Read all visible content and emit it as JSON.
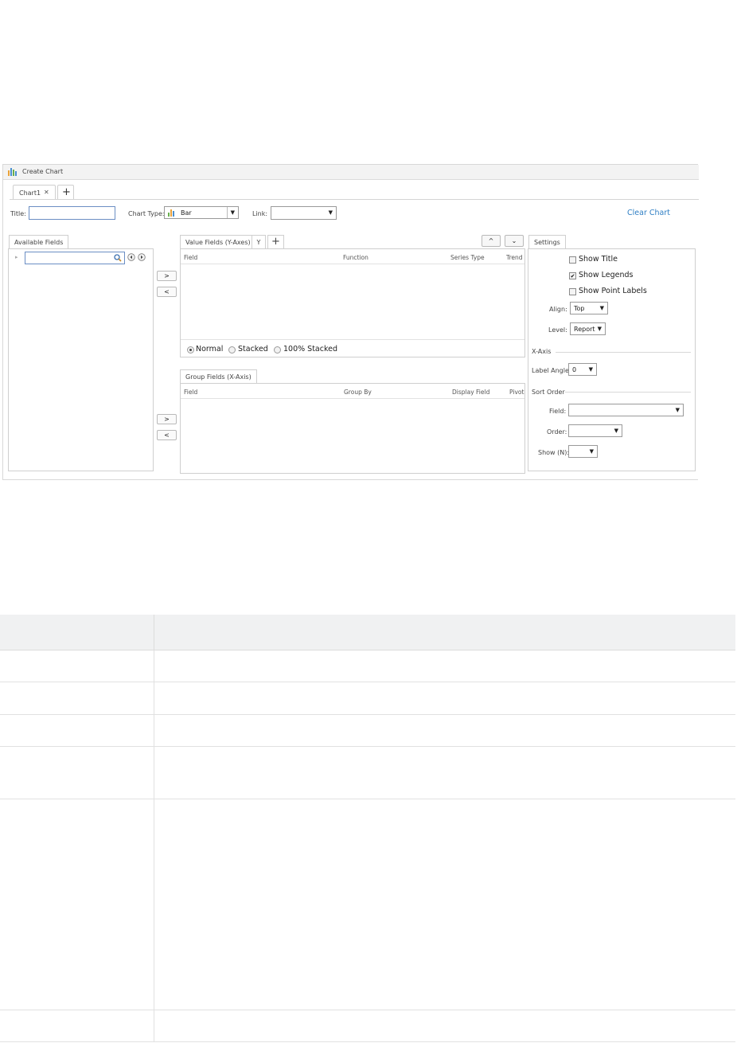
{
  "window": {
    "title": "Create Chart"
  },
  "tabs": [
    {
      "label": "Chart1",
      "close": "✕"
    }
  ],
  "add_tab": "+",
  "toolbar": {
    "title_label": "Title:",
    "title_value": "",
    "chart_type_label": "Chart Type:",
    "chart_type_value": "Bar",
    "link_label": "Link:",
    "link_value": "",
    "clear_chart": "Clear Chart"
  },
  "available_fields": {
    "tab": "Available Fields",
    "search_value": ""
  },
  "move_buttons": {
    "right": ">",
    "left": "<"
  },
  "value_fields": {
    "tab": "Value Fields (Y-Axes)",
    "y_tab": "Y",
    "add": "+",
    "up": "^",
    "down": "⌄",
    "columns": [
      "Field",
      "Function",
      "Series Type",
      "Trend"
    ],
    "modes": [
      "Normal",
      "Stacked",
      "100% Stacked"
    ]
  },
  "group_fields": {
    "tab": "Group Fields (X-Axis)",
    "columns": [
      "Field",
      "Group By",
      "Display Field",
      "Pivot"
    ]
  },
  "settings": {
    "tab": "Settings",
    "show_title": "Show Title",
    "show_legends": "Show Legends",
    "show_point_labels": "Show Point Labels",
    "check_mark": "✔",
    "align_label": "Align:",
    "align_value": "Top",
    "level_label": "Level:",
    "level_value": "Report",
    "x_axis": "X-Axis",
    "label_angle_label": "Label Angle:",
    "label_angle_value": "0",
    "sort_order": "Sort Order",
    "field_label": "Field:",
    "order_label": "Order:",
    "show_n_label": "Show (N):"
  },
  "colors": {
    "accent": "#2f7fc4",
    "input_border": "#6b8ec4"
  }
}
